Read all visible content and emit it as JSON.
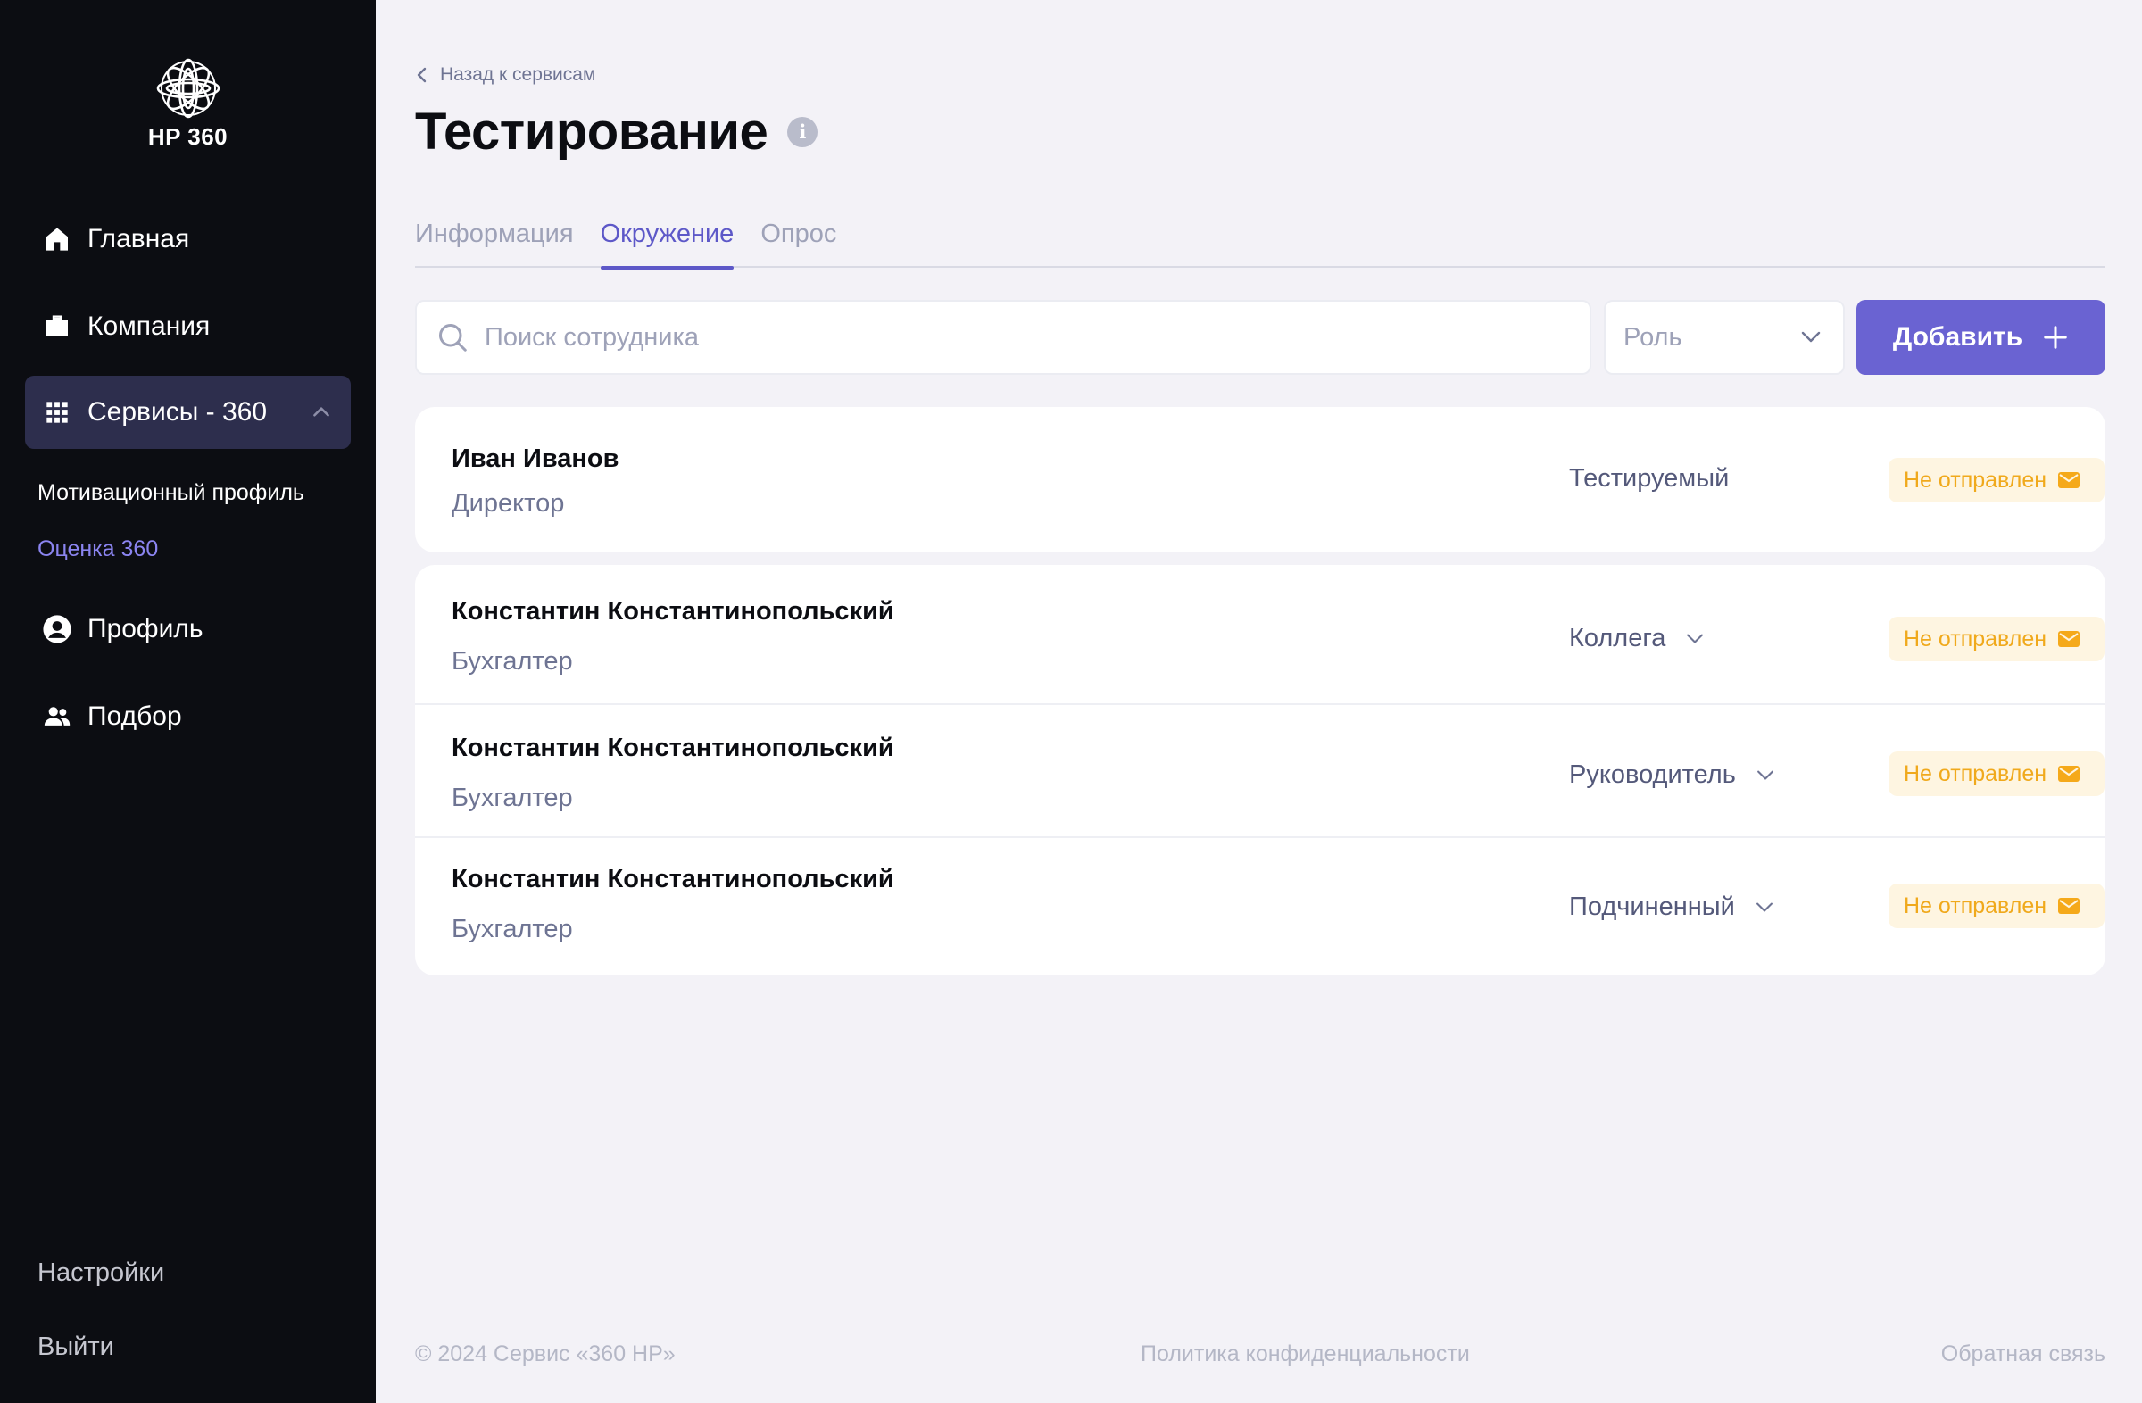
{
  "brand": {
    "name": "HP 360"
  },
  "sidebar": {
    "nav": [
      {
        "label": "Главная",
        "icon": "home-icon"
      },
      {
        "label": "Компания",
        "icon": "briefcase-icon"
      },
      {
        "label": "Сервисы - 360",
        "icon": "grid-icon",
        "active": true,
        "expanded": true
      }
    ],
    "subnav": [
      {
        "label": "Мотивационный профиль"
      },
      {
        "label": "Оценка 360",
        "active": true
      }
    ],
    "nav2": [
      {
        "label": "Профиль",
        "icon": "user-circle-icon"
      },
      {
        "label": "Подбор",
        "icon": "users-icon"
      }
    ],
    "settings": "Настройки",
    "logout": "Выйти"
  },
  "header": {
    "back": "Назад к сервисам",
    "title": "Тестирование",
    "info": "i"
  },
  "tabs": [
    {
      "label": "Информация"
    },
    {
      "label": "Окружение",
      "active": true
    },
    {
      "label": "Опрос"
    }
  ],
  "search": {
    "placeholder": "Поиск сотрудника",
    "value": ""
  },
  "role_filter": {
    "label": "Роль"
  },
  "add_button": {
    "label": "Добавить"
  },
  "subject": {
    "name": "Иван Иванов",
    "position": "Директор",
    "role": "Тестируемый",
    "status": "Не отправлен"
  },
  "environment": [
    {
      "name": "Константин Константинопольский",
      "position": "Бухгалтер",
      "role": "Коллега",
      "status": "Не отправлен"
    },
    {
      "name": "Константин Константинопольский",
      "position": "Бухгалтер",
      "role": "Руководитель",
      "status": "Не отправлен"
    },
    {
      "name": "Константин Константинопольский",
      "position": "Бухгалтер",
      "role": "Подчиненный",
      "status": "Не отправлен"
    }
  ],
  "footer": {
    "copyright": "© 2024 Сервис «360 HP»",
    "privacy": "Политика конфиденциальности",
    "feedback": "Обратная связь"
  },
  "colors": {
    "sidebar_bg": "#0c0d12",
    "accent": "#6a63d2",
    "badge_text": "#f0a91c",
    "badge_bg": "#fef5e1"
  }
}
